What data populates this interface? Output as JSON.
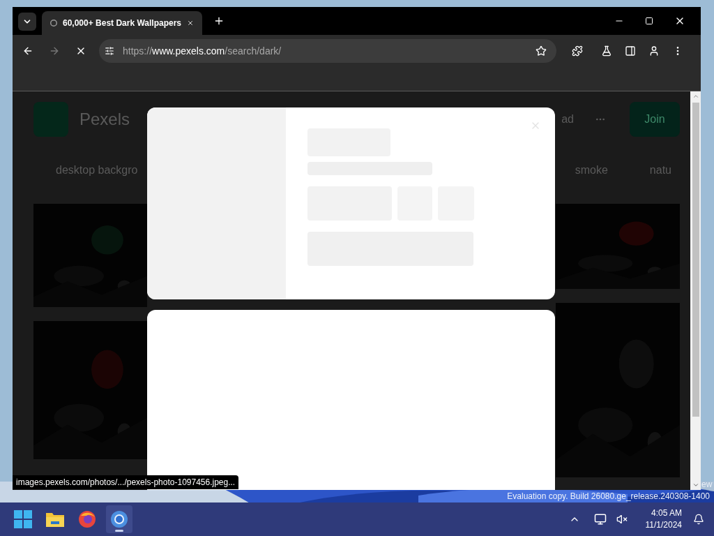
{
  "browser": {
    "tabs": [
      {
        "title": "60,000+ Best Dark Wallpapers",
        "selected": true
      }
    ],
    "address": {
      "scheme": "https://",
      "host": "www.pexels.com",
      "path": "/search/dark/"
    },
    "loading": true
  },
  "page": {
    "logo_text": "Pexels",
    "nav_text": "ad",
    "join_button": "Join",
    "tags": [
      "desktop backgro",
      "smoke",
      "natu"
    ]
  },
  "status_url": "images.pexels.com/photos/.../pexels-photo-1097456.jpeg...",
  "watermark": {
    "corner": "ew",
    "line": "Evaluation copy. Build 26080.ge_release.240308-1400"
  },
  "taskbar": {
    "apps": [
      {
        "kind": "start",
        "selected": false
      },
      {
        "kind": "explorer",
        "selected": false
      },
      {
        "kind": "firefox",
        "selected": false
      },
      {
        "kind": "chrome",
        "selected": true
      }
    ],
    "time": "4:05 AM",
    "date": "11/1/2024"
  }
}
